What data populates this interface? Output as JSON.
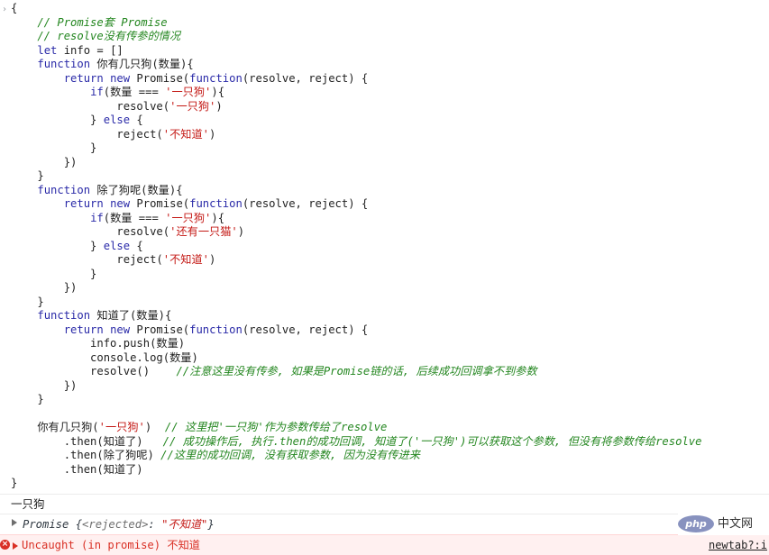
{
  "console": {
    "code_lines": [
      [
        {
          "t": "{",
          "c": "pn"
        }
      ],
      [
        {
          "t": "    // Promise套 Promise",
          "c": "cm"
        }
      ],
      [
        {
          "t": "    // resolve没有传参的情况",
          "c": "cm"
        }
      ],
      [
        {
          "t": "    ",
          "c": "pn"
        },
        {
          "t": "let",
          "c": "kw"
        },
        {
          "t": " info = []",
          "c": "pn"
        }
      ],
      [
        {
          "t": "    ",
          "c": "pn"
        },
        {
          "t": "function",
          "c": "kw"
        },
        {
          "t": " 你有几只狗(数量){",
          "c": "pn"
        }
      ],
      [
        {
          "t": "        ",
          "c": "pn"
        },
        {
          "t": "return new",
          "c": "kw"
        },
        {
          "t": " Promise(",
          "c": "pn"
        },
        {
          "t": "function",
          "c": "kw"
        },
        {
          "t": "(resolve, reject) {",
          "c": "pn"
        }
      ],
      [
        {
          "t": "            ",
          "c": "pn"
        },
        {
          "t": "if",
          "c": "kw"
        },
        {
          "t": "(数量 === ",
          "c": "pn"
        },
        {
          "t": "'一只狗'",
          "c": "str"
        },
        {
          "t": "){",
          "c": "pn"
        }
      ],
      [
        {
          "t": "                resolve(",
          "c": "pn"
        },
        {
          "t": "'一只狗'",
          "c": "str"
        },
        {
          "t": ")",
          "c": "pn"
        }
      ],
      [
        {
          "t": "            } ",
          "c": "pn"
        },
        {
          "t": "else",
          "c": "kw"
        },
        {
          "t": " {",
          "c": "pn"
        }
      ],
      [
        {
          "t": "                reject(",
          "c": "pn"
        },
        {
          "t": "'不知道'",
          "c": "str"
        },
        {
          "t": ")",
          "c": "pn"
        }
      ],
      [
        {
          "t": "            }",
          "c": "pn"
        }
      ],
      [
        {
          "t": "        })",
          "c": "pn"
        }
      ],
      [
        {
          "t": "    }",
          "c": "pn"
        }
      ],
      [
        {
          "t": "    ",
          "c": "pn"
        },
        {
          "t": "function",
          "c": "kw"
        },
        {
          "t": " 除了狗呢(数量){",
          "c": "pn"
        }
      ],
      [
        {
          "t": "        ",
          "c": "pn"
        },
        {
          "t": "return new",
          "c": "kw"
        },
        {
          "t": " Promise(",
          "c": "pn"
        },
        {
          "t": "function",
          "c": "kw"
        },
        {
          "t": "(resolve, reject) {",
          "c": "pn"
        }
      ],
      [
        {
          "t": "            ",
          "c": "pn"
        },
        {
          "t": "if",
          "c": "kw"
        },
        {
          "t": "(数量 === ",
          "c": "pn"
        },
        {
          "t": "'一只狗'",
          "c": "str"
        },
        {
          "t": "){",
          "c": "pn"
        }
      ],
      [
        {
          "t": "                resolve(",
          "c": "pn"
        },
        {
          "t": "'还有一只猫'",
          "c": "str"
        },
        {
          "t": ")",
          "c": "pn"
        }
      ],
      [
        {
          "t": "            } ",
          "c": "pn"
        },
        {
          "t": "else",
          "c": "kw"
        },
        {
          "t": " {",
          "c": "pn"
        }
      ],
      [
        {
          "t": "                reject(",
          "c": "pn"
        },
        {
          "t": "'不知道'",
          "c": "str"
        },
        {
          "t": ")",
          "c": "pn"
        }
      ],
      [
        {
          "t": "            }",
          "c": "pn"
        }
      ],
      [
        {
          "t": "        })",
          "c": "pn"
        }
      ],
      [
        {
          "t": "    }",
          "c": "pn"
        }
      ],
      [
        {
          "t": "    ",
          "c": "pn"
        },
        {
          "t": "function",
          "c": "kw"
        },
        {
          "t": " 知道了(数量){",
          "c": "pn"
        }
      ],
      [
        {
          "t": "        ",
          "c": "pn"
        },
        {
          "t": "return new",
          "c": "kw"
        },
        {
          "t": " Promise(",
          "c": "pn"
        },
        {
          "t": "function",
          "c": "kw"
        },
        {
          "t": "(resolve, reject) {",
          "c": "pn"
        }
      ],
      [
        {
          "t": "            info.push(数量)",
          "c": "pn"
        }
      ],
      [
        {
          "t": "            console.log(数量)",
          "c": "pn"
        }
      ],
      [
        {
          "t": "            resolve()    ",
          "c": "pn"
        },
        {
          "t": "//注意这里没有传参, 如果是Promise链的话, 后续成功回调拿不到参数",
          "c": "cm"
        }
      ],
      [
        {
          "t": "        })",
          "c": "pn"
        }
      ],
      [
        {
          "t": "    }",
          "c": "pn"
        }
      ],
      [
        {
          "t": "",
          "c": "pn"
        }
      ],
      [
        {
          "t": "    你有几只狗(",
          "c": "pn"
        },
        {
          "t": "'一只狗'",
          "c": "str"
        },
        {
          "t": ")  ",
          "c": "pn"
        },
        {
          "t": "// 这里把'一只狗'作为参数传给了resolve",
          "c": "cm"
        }
      ],
      [
        {
          "t": "        .then(知道了)   ",
          "c": "pn"
        },
        {
          "t": "// 成功操作后, 执行.then的成功回调, 知道了('一只狗')可以获取这个参数, 但没有将参数传给resolve",
          "c": "cm"
        }
      ],
      [
        {
          "t": "        .then(除了狗呢) ",
          "c": "pn"
        },
        {
          "t": "//这里的成功回调, 没有获取参数, 因为没有传进来",
          "c": "cm"
        }
      ],
      [
        {
          "t": "        .then(知道了)",
          "c": "pn"
        }
      ],
      [
        {
          "t": "}",
          "c": "pn"
        }
      ]
    ],
    "log_output": "一只狗",
    "promise_result": {
      "prefix": "Promise {",
      "key": "<rejected>",
      "sep": ": ",
      "value": "\"不知道\"",
      "suffix": "}"
    },
    "error": {
      "text": "Uncaught (in promise) 不知道",
      "source": "newtab?:i"
    },
    "icons": {
      "prompt": "chevron-right-icon",
      "expand": "expand-triangle-icon",
      "error": "error-circle-icon"
    },
    "colors": {
      "keyword": "#2a2aa8",
      "string": "#c41a16",
      "comment": "#23861f",
      "error": "#d93025",
      "error_bg": "#fff0f0"
    }
  },
  "watermark": {
    "logo_text": "php",
    "site_text": "中文网"
  }
}
